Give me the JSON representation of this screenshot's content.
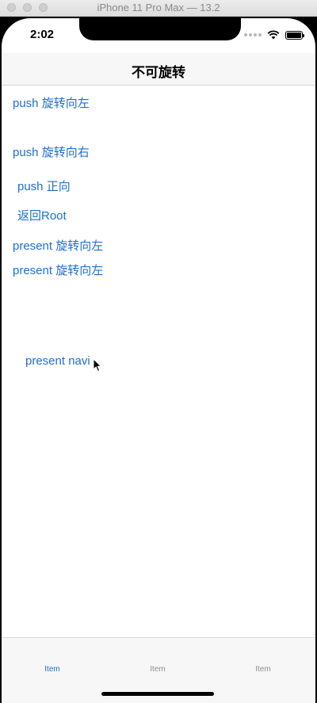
{
  "window": {
    "title": "iPhone 11 Pro Max — 13.2"
  },
  "status_bar": {
    "time": "2:02"
  },
  "nav": {
    "title": "不可旋转"
  },
  "buttons": {
    "push_left": "push 旋转向左",
    "push_right": "push 旋转向右",
    "push_portrait": "push 正向",
    "back_root": "返回Root",
    "present_left_1": "present 旋转向左",
    "present_left_2": "present 旋转向左",
    "present_navi": "present navi"
  },
  "tabs": [
    {
      "label": "Item"
    },
    {
      "label": "Item"
    },
    {
      "label": "Item"
    }
  ],
  "colors": {
    "tint": "#1f6fd0",
    "inactive": "#8e8e8e"
  },
  "icons": [
    "wifi-icon",
    "battery-icon",
    "signal-dots-icon",
    "cursor-icon"
  ]
}
